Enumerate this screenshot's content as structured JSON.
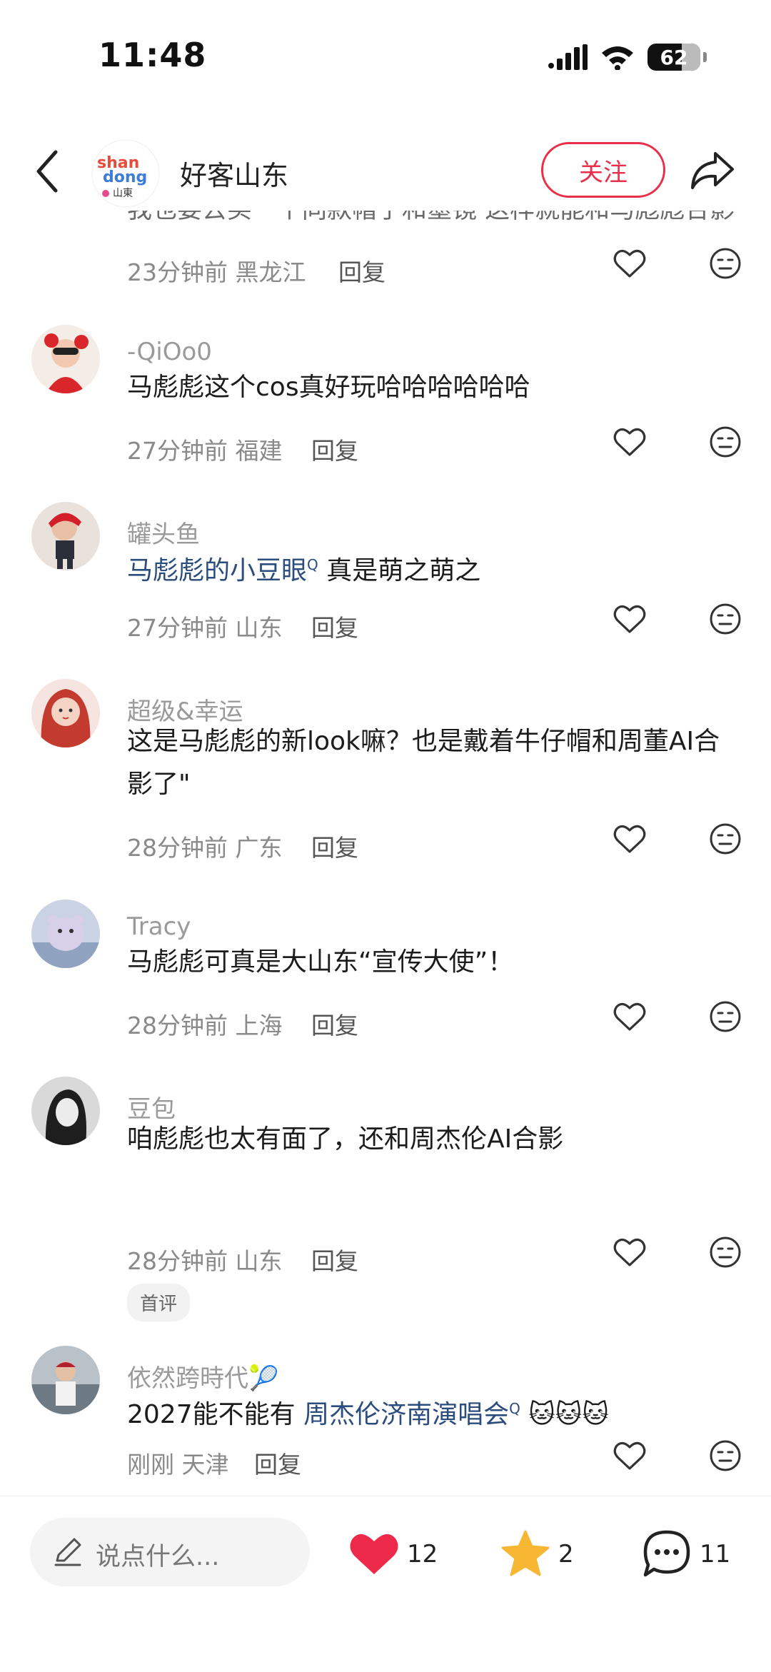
{
  "status_bar": {
    "time": "11:48",
    "battery": "62"
  },
  "header": {
    "account_name": "好客山东",
    "follow_label": "关注"
  },
  "partial_comment": {
    "text": "我也要去买一个同款帽子和墨镜 这样就能和马彪彪合影",
    "time": "23分钟前",
    "location": "黑龙江",
    "reply": "回复"
  },
  "comments": [
    {
      "username": "-QiOo0",
      "text": "马彪彪这个cos真好玩哈哈哈哈哈哈",
      "time": "27分钟前",
      "location": "福建",
      "reply": "回复"
    },
    {
      "username": "罐头鱼",
      "link": "马彪彪的小豆眼",
      "link_mark": "Q",
      "text": " 真是萌之萌之",
      "time": "27分钟前",
      "location": "山东",
      "reply": "回复"
    },
    {
      "username": "超级&幸运",
      "text": "这是马彪彪的新look嘛？也是戴着牛仔帽和周董AI合影了\"",
      "time": "28分钟前",
      "location": "广东",
      "reply": "回复"
    },
    {
      "username": "Tracy",
      "text": "马彪彪可真是大山东“宣传大使”！",
      "time": "28分钟前",
      "location": "上海",
      "reply": "回复"
    },
    {
      "username": "豆包",
      "text": "咱彪彪也太有面了，还和周杰伦AI合影",
      "time": "28分钟前",
      "location": "山东",
      "reply": "回复",
      "badge": "首评"
    },
    {
      "username": "依然跨時代",
      "username_emoji": "🎾",
      "text_prefix": "2027能不能有 ",
      "link": "周杰伦济南演唱会",
      "link_mark": "Q",
      "emojis": "🐱🐱🐱",
      "time": "刚刚",
      "location": "天津",
      "reply": "回复"
    }
  ],
  "bottom_bar": {
    "input_placeholder": "说点什么...",
    "likes": "12",
    "stars": "2",
    "comments": "11"
  },
  "colors": {
    "accent": "#e8304a",
    "link": "#2b4d7e",
    "heart": "#ee2a4a",
    "star": "#f7b733"
  }
}
